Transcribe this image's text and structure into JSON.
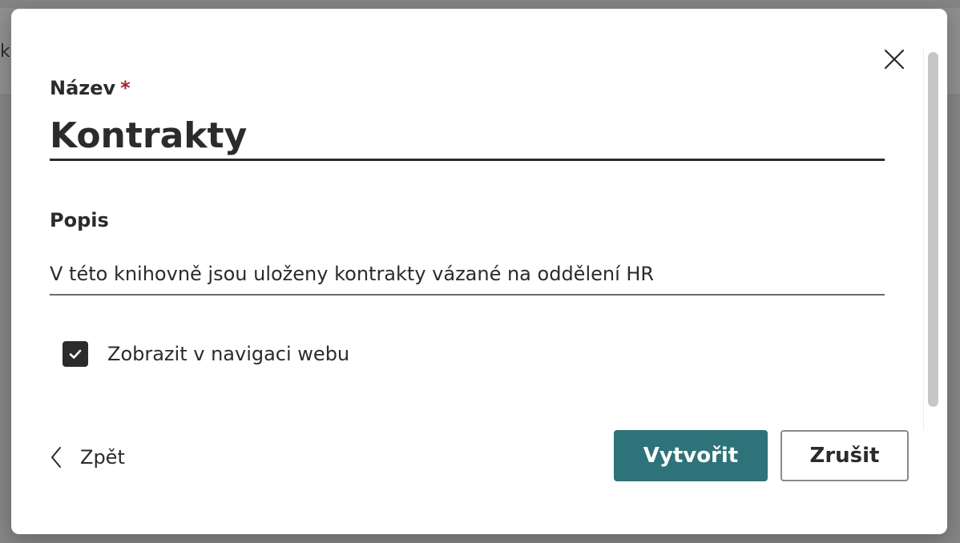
{
  "background": {
    "partial_text": "k"
  },
  "dialog": {
    "name_field": {
      "label": "Název",
      "required_marker": "*",
      "value": "Kontrakty"
    },
    "description_field": {
      "label": "Popis",
      "value": "V této knihovně jsou uloženy kontrakty vázané na oddělení HR"
    },
    "show_in_navigation": {
      "label": "Zobrazit v navigaci webu",
      "checked": true
    },
    "footer": {
      "back_label": "Zpět",
      "create_label": "Vytvořit",
      "cancel_label": "Zrušit"
    },
    "icons": {
      "close": "close-icon",
      "back": "chevron-left-icon",
      "checkmark": "checkmark-icon"
    }
  },
  "colors": {
    "primary_button": "#2e7379",
    "required": "#a4262c",
    "text": "#2b2b2b"
  }
}
